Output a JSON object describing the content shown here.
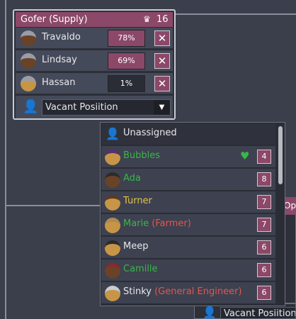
{
  "job_panel": {
    "title": "Gofer (Supply)",
    "crown_icon": "crown-icon",
    "capacity": "16",
    "assigned": [
      {
        "name": "Travaldo",
        "percent": "78%",
        "remove_icon": "close-icon"
      },
      {
        "name": "Lindsay",
        "percent": "69%",
        "remove_icon": "close-icon"
      },
      {
        "name": "Hassan",
        "percent": "1%",
        "remove_icon": "close-icon"
      }
    ],
    "vacant": {
      "icon": "person-icon",
      "value": "Vacant Posiition",
      "arrow_icon": "chevron-down-icon"
    }
  },
  "dropdown": {
    "options": [
      {
        "name": "Unassigned",
        "extra": "",
        "badge": ""
      },
      {
        "name": "Bubbles",
        "extra": "",
        "badge": "4",
        "heart_icon": "heart-icon"
      },
      {
        "name": "Ada",
        "extra": "",
        "badge": "8"
      },
      {
        "name": "Turner",
        "extra": "",
        "badge": "7"
      },
      {
        "name": "Marie",
        "extra": "(Farmer)",
        "badge": "7"
      },
      {
        "name": "Meep",
        "extra": "",
        "badge": "6"
      },
      {
        "name": "Camille",
        "extra": "",
        "badge": "6"
      },
      {
        "name": "Stinky",
        "extra": "(General Engineer)",
        "badge": "6"
      }
    ]
  },
  "background": {
    "op_tab": "Op",
    "bottom_select": "Vacant Posiition"
  },
  "colors": {
    "accent": "#8b4868",
    "green_name": "#3bb548",
    "yellow_name": "#e5c24a",
    "red_trait": "#e3564f"
  }
}
